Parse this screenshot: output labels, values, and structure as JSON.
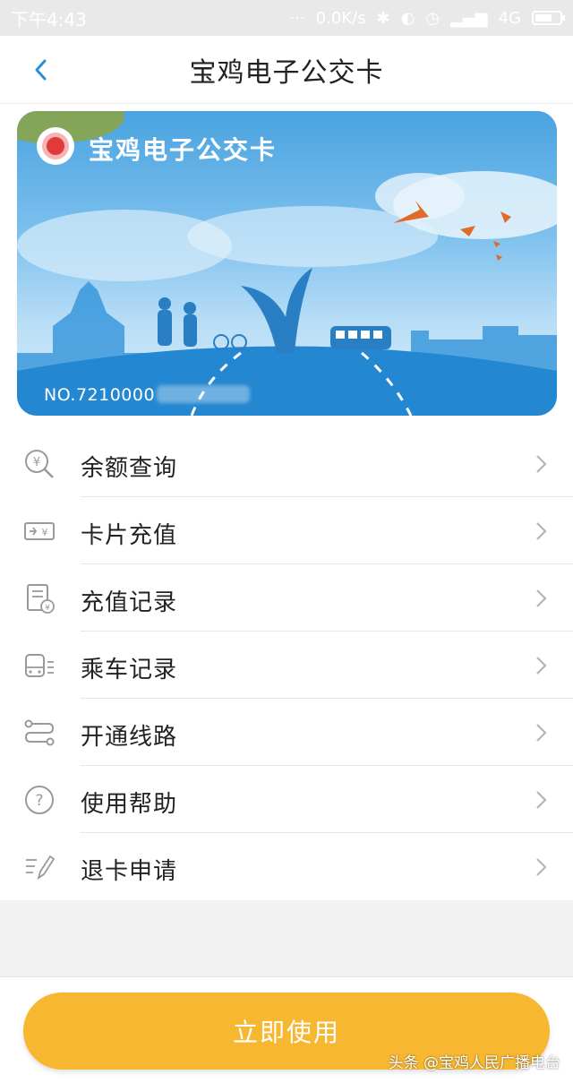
{
  "status_bar": {
    "time": "下午4:43",
    "network_speed": "0.0K/s",
    "network_type": "4G"
  },
  "nav": {
    "title": "宝鸡电子公交卡",
    "back_icon": "chevron-left-icon"
  },
  "card": {
    "title": "宝鸡电子公交卡",
    "number": "NO.7210000"
  },
  "menu": {
    "items": [
      {
        "label": "余额查询",
        "icon": "yuan-search-icon"
      },
      {
        "label": "卡片充值",
        "icon": "card-recharge-icon"
      },
      {
        "label": "充值记录",
        "icon": "recharge-record-icon"
      },
      {
        "label": "乘车记录",
        "icon": "bus-record-icon"
      },
      {
        "label": "开通线路",
        "icon": "route-icon"
      },
      {
        "label": "使用帮助",
        "icon": "help-icon"
      },
      {
        "label": "退卡申请",
        "icon": "refund-edit-icon"
      }
    ]
  },
  "action": {
    "use_button_label": "立即使用"
  },
  "watermark": "头条 @宝鸡人民广播电台",
  "colors": {
    "accent": "#f7b731",
    "nav_back": "#2a8fd8",
    "card_sky": "#4aa3e0",
    "icon_gray": "#9a9a9a"
  }
}
